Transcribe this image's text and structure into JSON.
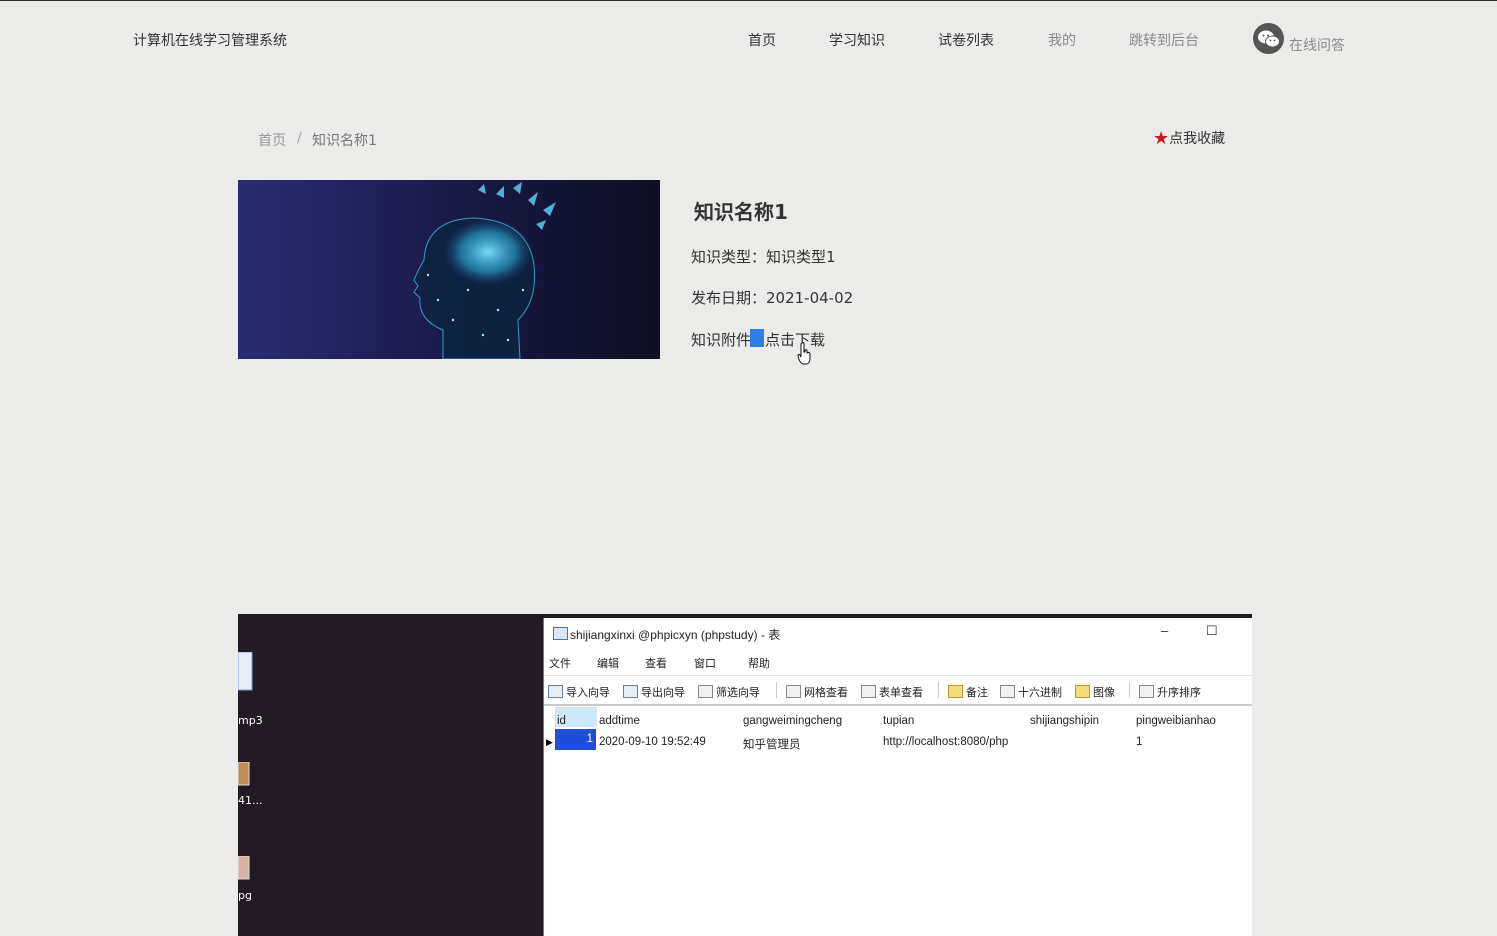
{
  "header": {
    "site_title": "计算机在线学习管理系统",
    "nav": [
      "首页",
      "学习知识",
      "试卷列表",
      "我的",
      "跳转到后台"
    ],
    "online_qa": "在线问答"
  },
  "breadcrumb": {
    "home": "首页",
    "separator": "/",
    "current": "知识名称1"
  },
  "favorite_label": "点我收藏",
  "knowledge": {
    "title": "知识名称1",
    "type_line": "知识类型：知识类型1",
    "date_line": "发布日期：2021-04-02",
    "attachment_label": "知识附件：",
    "download_link": "点击下载"
  },
  "desktop": {
    "items": [
      "mp3",
      "41...",
      "pg"
    ]
  },
  "db_window": {
    "title": "shijiangxinxi @phpicxyn (phpstudy) - 表",
    "controls": {
      "minimize": "–",
      "maximize": "☐"
    },
    "menu": [
      "文件",
      "编辑",
      "查看",
      "窗口",
      "帮助"
    ],
    "toolbar": [
      "导入向导",
      "导出向导",
      "筛选向导",
      "网格查看",
      "表单查看",
      "备注",
      "十六进制",
      "图像",
      "升序排序"
    ],
    "columns": [
      "id",
      "addtime",
      "gangweimingcheng",
      "tupian",
      "shijiangshipin",
      "pingweibianhao"
    ],
    "rows": [
      [
        "1",
        "2020-09-10 19:52:49",
        "知乎管理员",
        "http://localhost:8080/php",
        "",
        "1"
      ]
    ]
  },
  "colors": {
    "background": "#ebebe9",
    "star": "#c81b1b",
    "selection": "#2f7fe3",
    "grid_selected": "#1f4fd8"
  }
}
